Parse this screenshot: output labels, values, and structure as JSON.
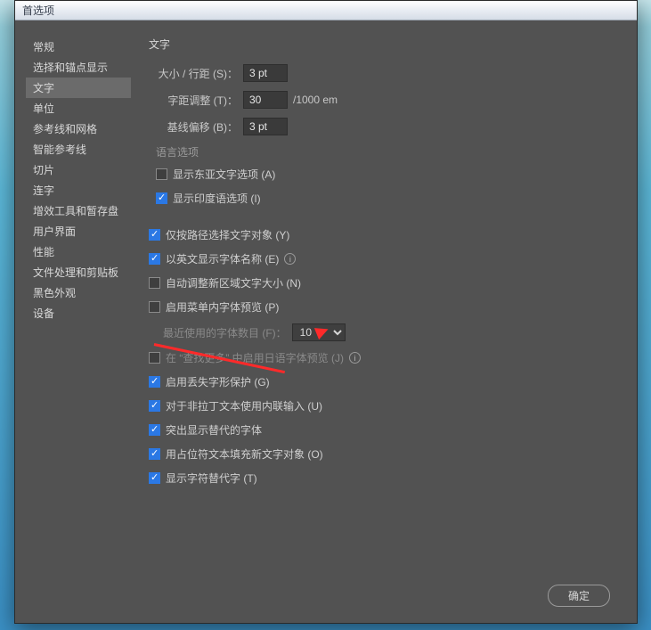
{
  "window": {
    "title": "首选项"
  },
  "sidebar": {
    "items": [
      {
        "label": "常规",
        "active": false
      },
      {
        "label": "选择和锚点显示",
        "active": false
      },
      {
        "label": "文字",
        "active": true
      },
      {
        "label": "单位",
        "active": false
      },
      {
        "label": "参考线和网格",
        "active": false
      },
      {
        "label": "智能参考线",
        "active": false
      },
      {
        "label": "切片",
        "active": false
      },
      {
        "label": "连字",
        "active": false
      },
      {
        "label": "增效工具和暂存盘",
        "active": false
      },
      {
        "label": "用户界面",
        "active": false
      },
      {
        "label": "性能",
        "active": false
      },
      {
        "label": "文件处理和剪贴板",
        "active": false
      },
      {
        "label": "黑色外观",
        "active": false
      },
      {
        "label": "设备",
        "active": false
      }
    ]
  },
  "main": {
    "title": "文字",
    "size_leading_label": "大小 / 行距 (S)：",
    "size_leading_value": "3 pt",
    "tracking_label": "字距调整 (T)：",
    "tracking_value": "30",
    "tracking_unit": "/1000 em",
    "baseline_label": "基线偏移 (B)：",
    "baseline_value": "3 pt",
    "lang_header": "语言选项",
    "chk_east_asian": "显示东亚文字选项 (A)",
    "chk_indic": "显示印度语选项 (I)",
    "chk_path_only": "仅按路径选择文字对象 (Y)",
    "chk_english_names": "以英文显示字体名称 (E)",
    "chk_auto_size": "自动调整新区域文字大小 (N)",
    "chk_preview_menu": "启用菜单内字体预览 (P)",
    "recent_fonts_label": "最近使用的字体数目 (F)：",
    "recent_fonts_value": "10",
    "chk_jp_preview": "在 “查找更多” 中启用日语字体预览 (J)",
    "chk_missing_glyph": "启用丢失字形保护 (G)",
    "chk_inline_input": "对于非拉丁文本使用内联输入 (U)",
    "chk_highlight_alt": "突出显示替代的字体",
    "chk_placeholder_fill": "用占位符文本填充新文字对象 (O)",
    "chk_show_alt_glyph": "显示字符替代字 (T)",
    "ok_text": "确定"
  }
}
